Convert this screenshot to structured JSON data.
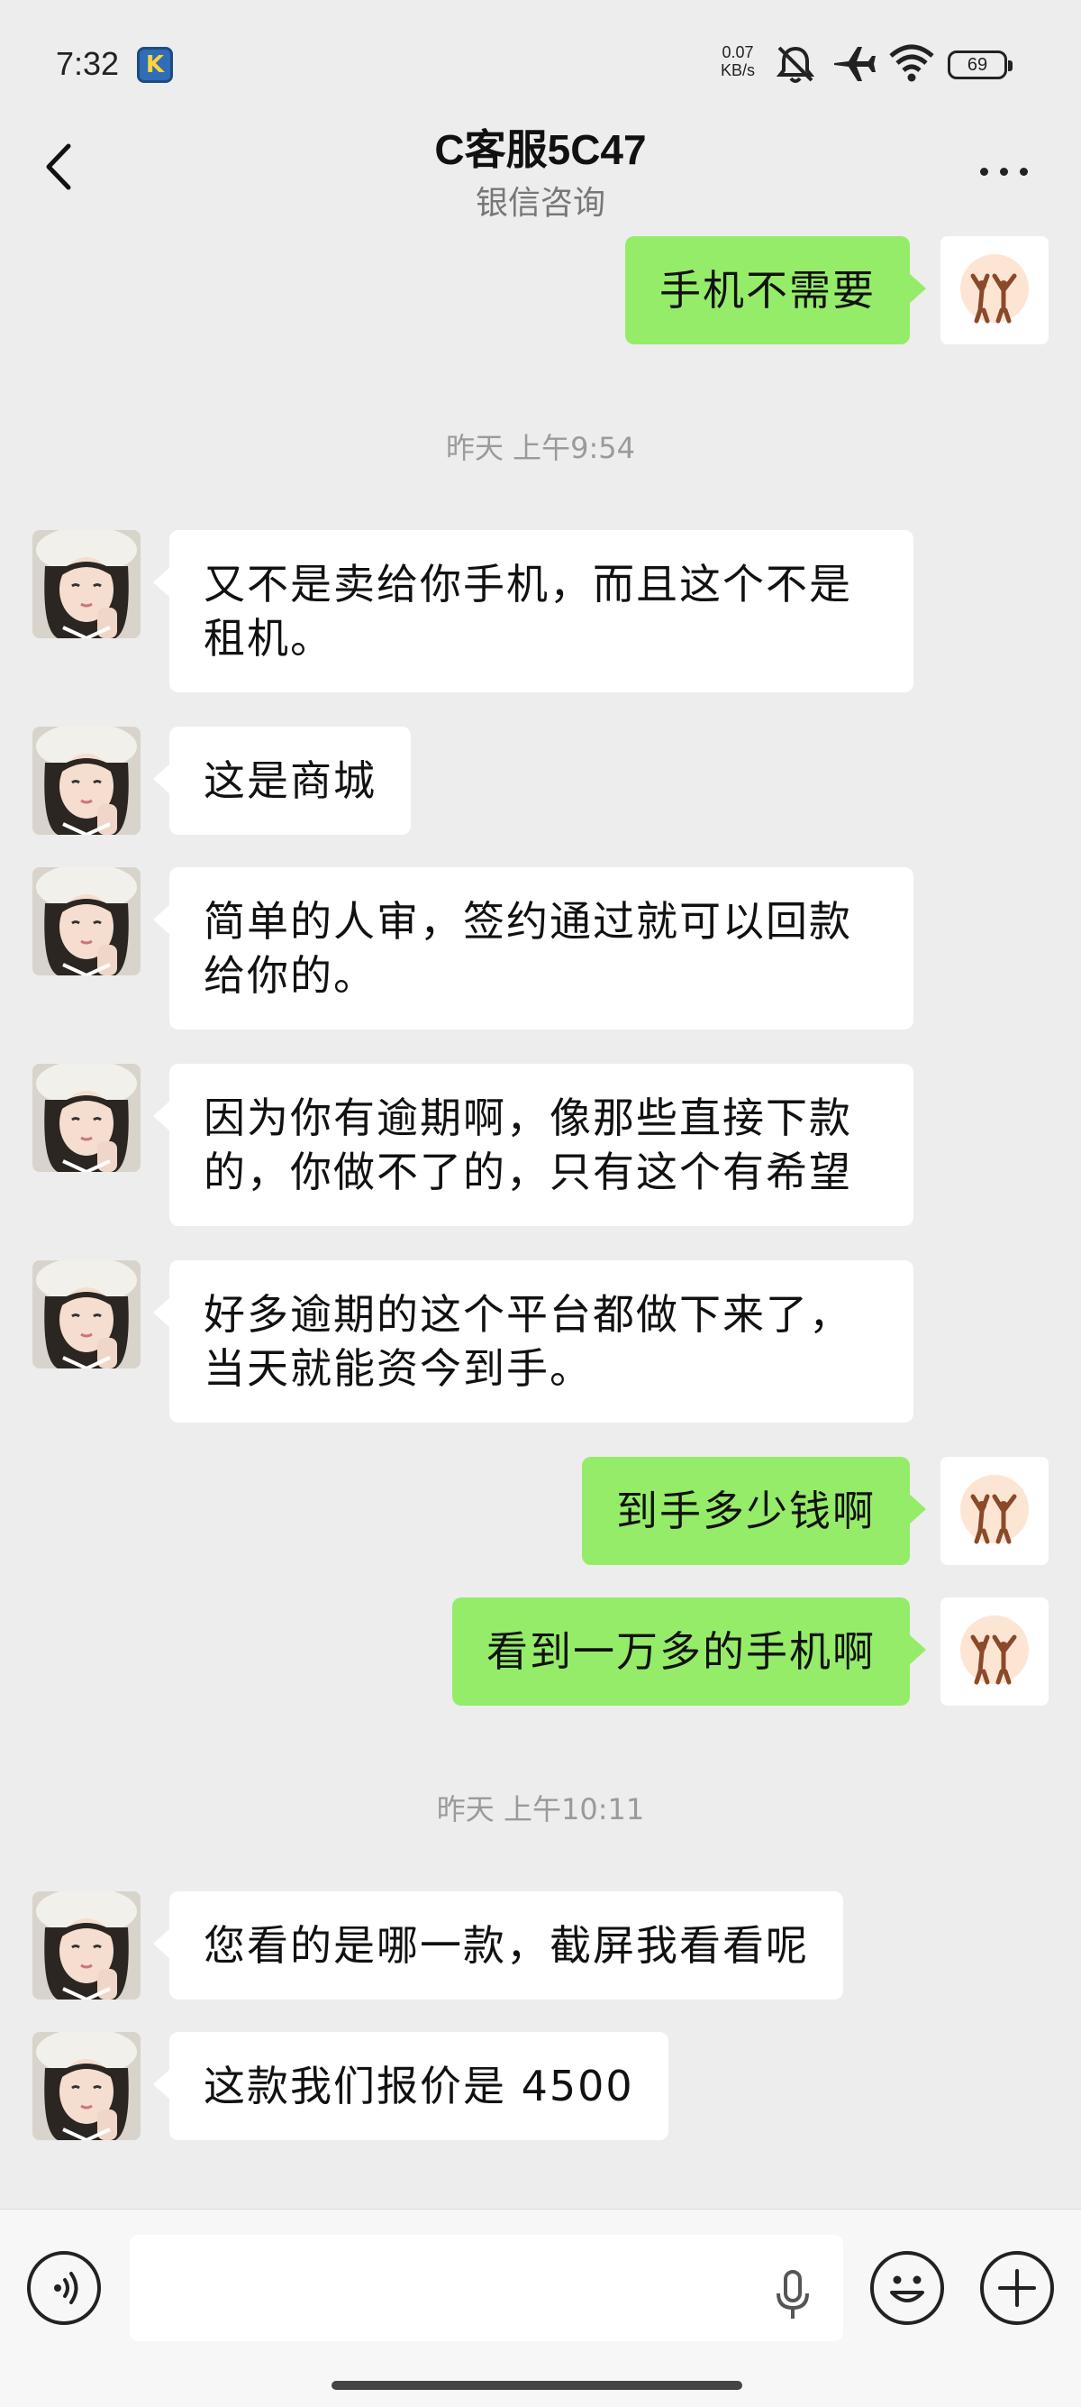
{
  "status_bar": {
    "time": "7:32",
    "network_speed_value": "0.07",
    "network_speed_unit": "KB/s",
    "battery": "69",
    "icons": [
      "app-k-icon",
      "mute-icon",
      "airplane-icon",
      "wifi-icon",
      "battery-icon"
    ]
  },
  "header": {
    "title": "C客服5C47",
    "subtitle": "银信咨询"
  },
  "messages": [
    {
      "from": "me",
      "text": "手机不需要"
    },
    {
      "type": "time",
      "text": "昨天 上午9:54"
    },
    {
      "from": "other",
      "lines": [
        "又不是卖给你手机，而且这个不是",
        "租机。"
      ]
    },
    {
      "from": "other",
      "lines": [
        "这是商城"
      ]
    },
    {
      "from": "other",
      "lines": [
        "简单的人审，签约通过就可以回款",
        "给你的。"
      ]
    },
    {
      "from": "other",
      "lines": [
        "因为你有逾期啊，像那些直接下款",
        "的，你做不了的，只有这个有希望"
      ]
    },
    {
      "from": "other",
      "lines": [
        "好多逾期的这个平台都做下来了，",
        "当天就能资今到手。"
      ]
    },
    {
      "from": "me",
      "text": "到手多少钱啊"
    },
    {
      "from": "me",
      "text": "看到一万多的手机啊"
    },
    {
      "type": "time",
      "text": "昨天 上午10:11"
    },
    {
      "from": "other",
      "lines": [
        "您看的是哪一款，截屏我看看呢"
      ]
    },
    {
      "from": "other",
      "lines": [
        "这款我们报价是 4500"
      ]
    }
  ],
  "input_bar": {
    "voice_toggle": "voice-icon",
    "mic": "mic-icon",
    "emoji": "emoji-icon",
    "more": "plus-icon",
    "input_value": ""
  },
  "colors": {
    "background": "#ededed",
    "bubble_out": "#95ec69",
    "bubble_in": "#ffffff"
  }
}
